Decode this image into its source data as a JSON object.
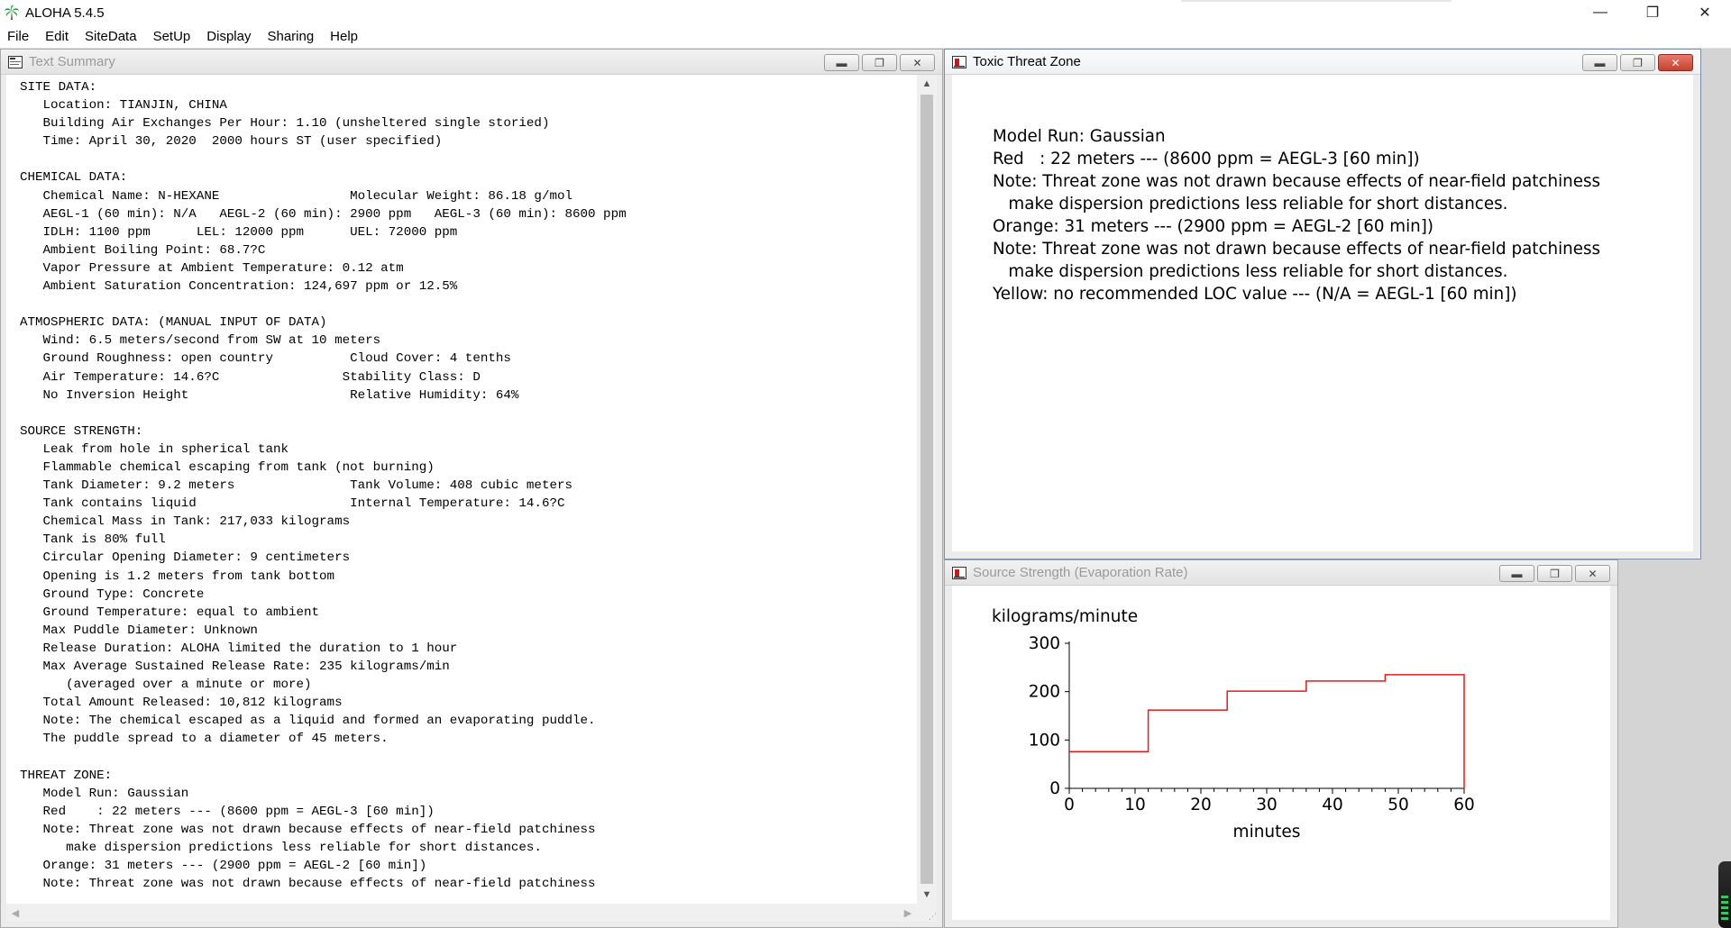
{
  "app": {
    "title": "ALOHA 5.4.5",
    "window_controls": {
      "minimize": "—",
      "restore": "❐",
      "close": "✕"
    }
  },
  "menu": [
    "File",
    "Edit",
    "SiteData",
    "SetUp",
    "Display",
    "Sharing",
    "Help"
  ],
  "windows": {
    "text_summary": {
      "title": "Text Summary",
      "lines": [
        "SITE DATA:",
        "   Location: TIANJIN, CHINA",
        "   Building Air Exchanges Per Hour: 1.10 (unsheltered single storied)",
        "   Time: April 30, 2020  2000 hours ST (user specified)",
        "",
        "CHEMICAL DATA:",
        "   Chemical Name: N-HEXANE                 Molecular Weight: 86.18 g/mol",
        "   AEGL-1 (60 min): N/A   AEGL-2 (60 min): 2900 ppm   AEGL-3 (60 min): 8600 ppm",
        "   IDLH: 1100 ppm      LEL: 12000 ppm      UEL: 72000 ppm",
        "   Ambient Boiling Point: 68.7?C",
        "   Vapor Pressure at Ambient Temperature: 0.12 atm",
        "   Ambient Saturation Concentration: 124,697 ppm or 12.5%",
        "",
        "ATMOSPHERIC DATA: (MANUAL INPUT OF DATA)",
        "   Wind: 6.5 meters/second from SW at 10 meters",
        "   Ground Roughness: open country          Cloud Cover: 4 tenths",
        "   Air Temperature: 14.6?C                Stability Class: D",
        "   No Inversion Height                     Relative Humidity: 64%",
        "",
        "SOURCE STRENGTH:",
        "   Leak from hole in spherical tank",
        "   Flammable chemical escaping from tank (not burning)",
        "   Tank Diameter: 9.2 meters               Tank Volume: 408 cubic meters",
        "   Tank contains liquid                    Internal Temperature: 14.6?C",
        "   Chemical Mass in Tank: 217,033 kilograms",
        "   Tank is 80% full",
        "   Circular Opening Diameter: 9 centimeters",
        "   Opening is 1.2 meters from tank bottom",
        "   Ground Type: Concrete",
        "   Ground Temperature: equal to ambient",
        "   Max Puddle Diameter: Unknown",
        "   Release Duration: ALOHA limited the duration to 1 hour",
        "   Max Average Sustained Release Rate: 235 kilograms/min",
        "      (averaged over a minute or more)",
        "   Total Amount Released: 10,812 kilograms",
        "   Note: The chemical escaped as a liquid and formed an evaporating puddle.",
        "   The puddle spread to a diameter of 45 meters.",
        "",
        "THREAT ZONE:",
        "   Model Run: Gaussian",
        "   Red    : 22 meters --- (8600 ppm = AEGL-3 [60 min])",
        "   Note: Threat zone was not drawn because effects of near-field patchiness",
        "      make dispersion predictions less reliable for short distances.",
        "   Orange: 31 meters --- (2900 ppm = AEGL-2 [60 min])",
        "   Note: Threat zone was not drawn because effects of near-field patchiness"
      ]
    },
    "toxic_threat_zone": {
      "title": "Toxic Threat Zone",
      "lines": [
        "Model Run: Gaussian",
        "Red   : 22 meters --- (8600 ppm = AEGL-3 [60 min])",
        "Note: Threat zone was not drawn because effects of near-field patchiness",
        "   make dispersion predictions less reliable for short distances.",
        "Orange: 31 meters --- (2900 ppm = AEGL-2 [60 min])",
        "Note: Threat zone was not drawn because effects of near-field patchiness",
        "   make dispersion predictions less reliable for short distances.",
        "Yellow: no recommended LOC value --- (N/A = AEGL-1 [60 min])"
      ]
    },
    "source_strength": {
      "title": "Source Strength (Evaporation Rate)"
    }
  },
  "chart_data": {
    "type": "line",
    "step": true,
    "ylabel": "kilograms/minute",
    "xlabel": "minutes",
    "xlim": [
      0,
      60
    ],
    "ylim": [
      0,
      300
    ],
    "x_ticks": [
      0,
      10,
      20,
      30,
      40,
      50,
      60
    ],
    "y_ticks": [
      0,
      100,
      200,
      300
    ],
    "series": [
      {
        "color": "#e8191b",
        "x": [
          0,
          12,
          12,
          24,
          24,
          36,
          36,
          48,
          48,
          60,
          60
        ],
        "y": [
          76,
          76,
          162,
          162,
          201,
          201,
          222,
          222,
          235,
          235,
          0
        ]
      }
    ],
    "grid": false
  },
  "colors": {
    "line": "#e8191b",
    "workspace": "#d4d4d4"
  }
}
